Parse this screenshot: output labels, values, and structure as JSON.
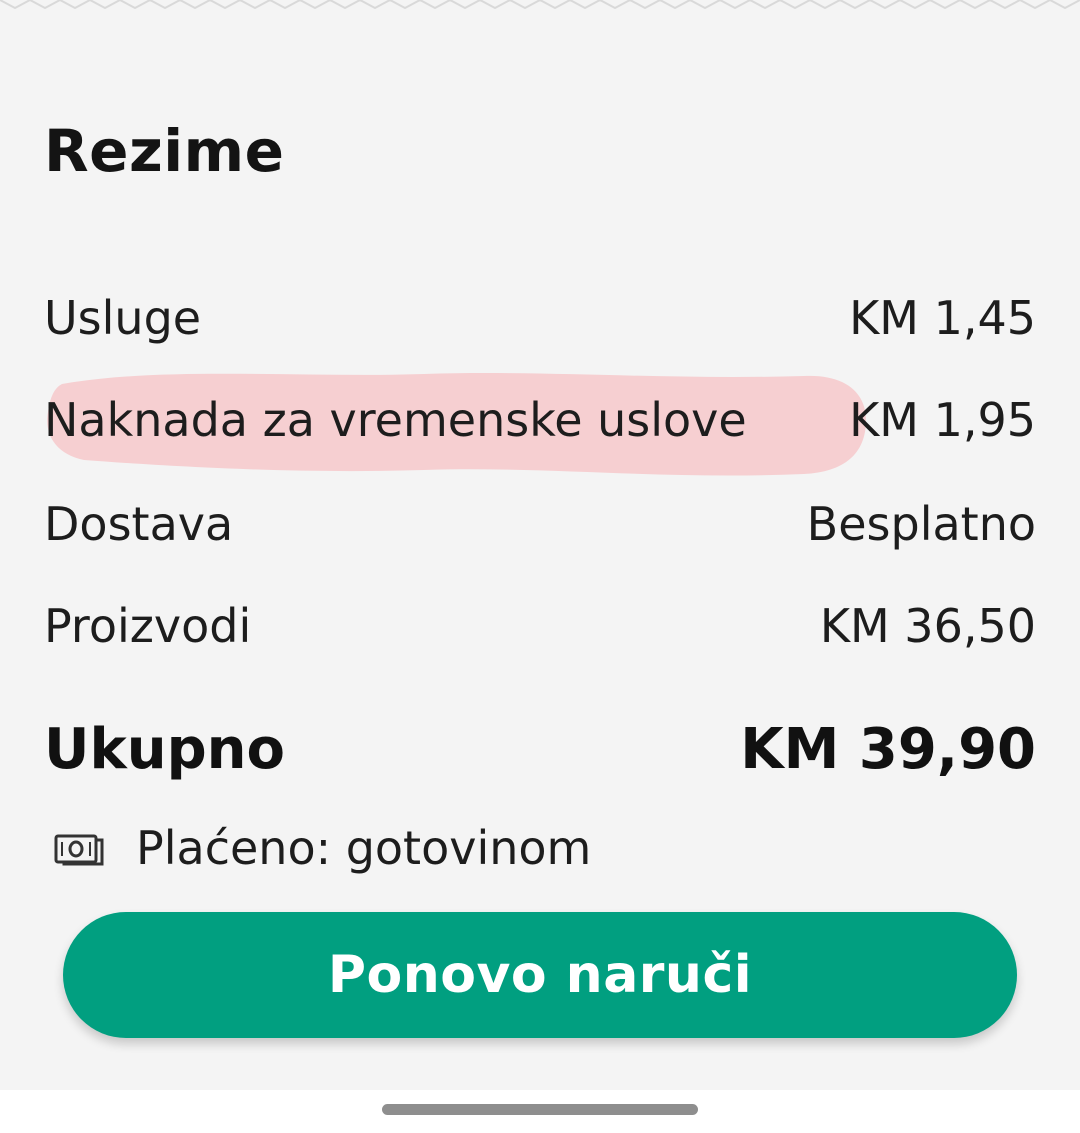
{
  "summary": {
    "title": "Rezime",
    "rows": [
      {
        "label": "Usluge",
        "value": "KM 1,45"
      },
      {
        "label": "Naknada za vremenske uslove",
        "value": "KM 1,95"
      },
      {
        "label": "Dostava",
        "value": "Besplatno"
      },
      {
        "label": "Proizvodi",
        "value": "KM 36,50"
      }
    ],
    "total": {
      "label": "Ukupno",
      "value": "KM 39,90"
    },
    "payment": {
      "icon": "cash-icon",
      "text": "Plaćeno: gotovinom"
    }
  },
  "actions": {
    "reorder_label": "Ponovo naruči"
  },
  "colors": {
    "background": "#f4f4f4",
    "accent": "#019f80",
    "highlight": "#f6cfd1"
  }
}
